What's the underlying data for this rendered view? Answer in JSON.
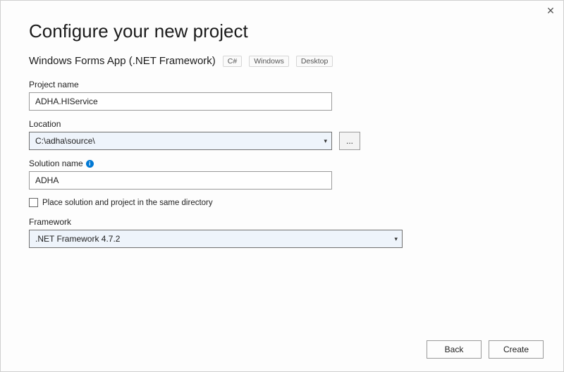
{
  "close_glyph": "✕",
  "title": "Configure your new project",
  "subhead": {
    "template_name": "Windows Forms App (.NET Framework)",
    "tags": [
      "C#",
      "Windows",
      "Desktop"
    ]
  },
  "fields": {
    "project_name": {
      "label": "Project name",
      "value": "ADHA.HIService"
    },
    "location": {
      "label": "Location",
      "value": "C:\\adha\\source\\",
      "browse": "..."
    },
    "solution_name": {
      "label": "Solution name",
      "value": "ADHA",
      "info_tooltip": "i"
    },
    "same_dir": {
      "label": "Place solution and project in the same directory",
      "checked": false
    },
    "framework": {
      "label": "Framework",
      "value": ".NET Framework 4.7.2"
    }
  },
  "buttons": {
    "back": "Back",
    "create": "Create"
  }
}
